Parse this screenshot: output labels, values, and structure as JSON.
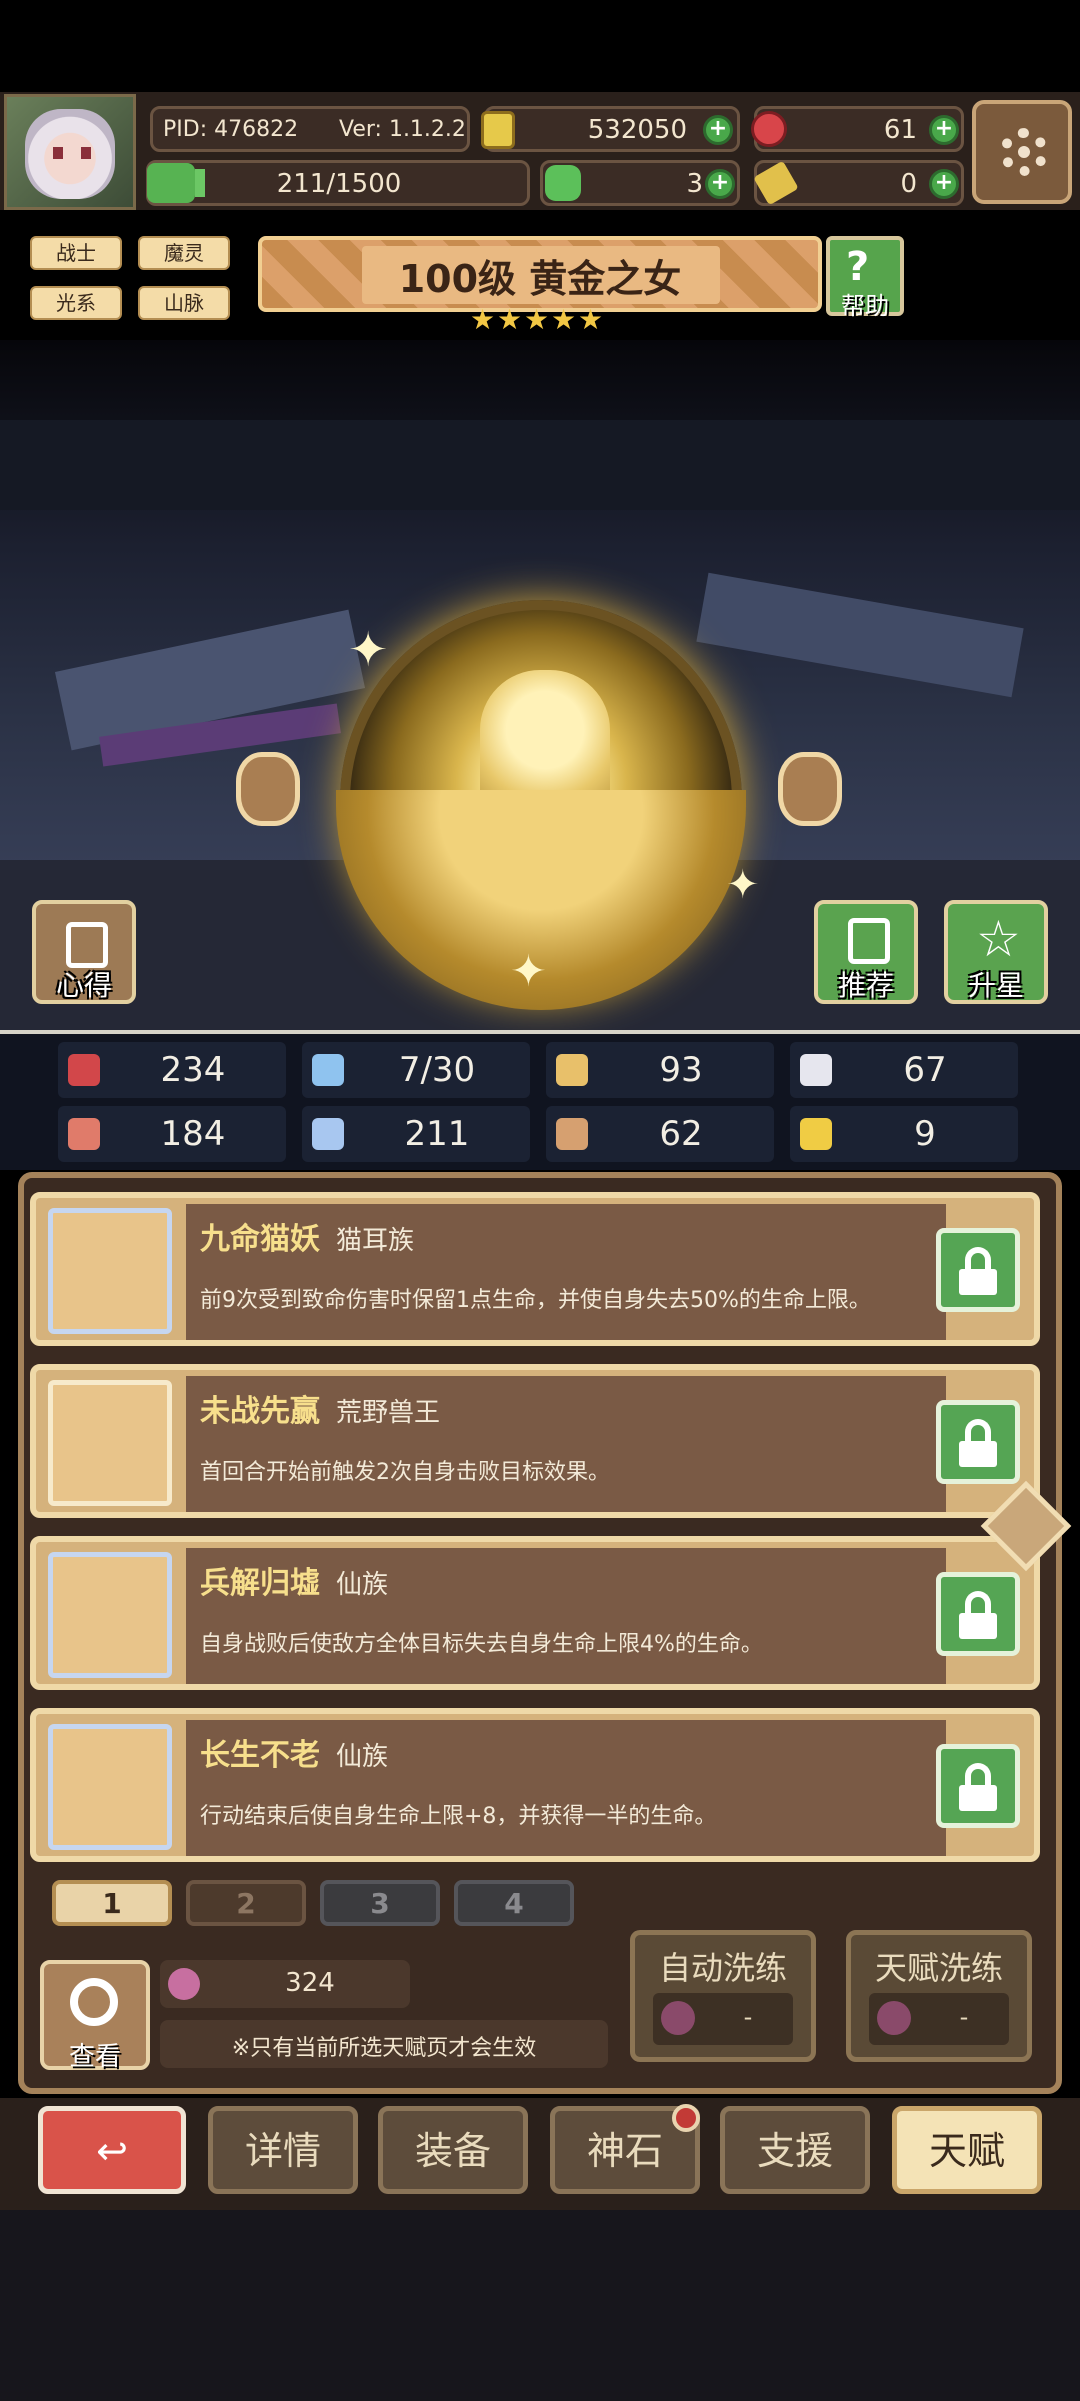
{
  "header": {
    "pid": "PID: 476822",
    "version": "Ver: 1.1.2.2",
    "gold": "532050",
    "gems": "61",
    "energy": "211/1500",
    "clover": "3",
    "keys": "0"
  },
  "tags": [
    "战士",
    "魔灵",
    "光系",
    "山脉"
  ],
  "hero": {
    "title": "100级 黄金之女",
    "stars": 5,
    "help_label": "帮助"
  },
  "scene_buttons": {
    "notes": "心得",
    "recommend": "推荐",
    "star_up": "升星"
  },
  "stats": [
    {
      "icon": "heart-icon",
      "value": "234"
    },
    {
      "icon": "water-drop-icon",
      "value": "7/30"
    },
    {
      "icon": "shield-icon",
      "value": "93"
    },
    {
      "icon": "boot-icon",
      "value": "67"
    },
    {
      "icon": "fist-icon",
      "value": "184"
    },
    {
      "icon": "book-icon",
      "value": "211"
    },
    {
      "icon": "armor-icon",
      "value": "62"
    },
    {
      "icon": "horseshoe-icon",
      "value": "9"
    }
  ],
  "talents": [
    {
      "name": "九命猫妖",
      "tribe": "猫耳族",
      "desc": "前9次受到致命伤害时保留1点生命，并使自身失去50%的生命上限。"
    },
    {
      "name": "未战先赢",
      "tribe": "荒野兽王",
      "desc": "首回合开始前触发2次自身击败目标效果。"
    },
    {
      "name": "兵解归墟",
      "tribe": "仙族",
      "desc": "自身战败后使敌方全体目标失去自身生命上限4%的生命。"
    },
    {
      "name": "长生不老",
      "tribe": "仙族",
      "desc": "行动结束后使自身生命上限+8，并获得一半的生命。"
    }
  ],
  "pages": [
    "1",
    "2",
    "3",
    "4"
  ],
  "panel": {
    "view_label": "查看",
    "berry_count": "324",
    "note": "※只有当前所选天赋页才会生效",
    "auto_refine": "自动洗练",
    "auto_refine_cost": "-",
    "talent_refine": "天赋洗练",
    "talent_refine_cost": "-"
  },
  "nav": {
    "details": "详情",
    "equip": "装备",
    "godstone": "神石",
    "support": "支援",
    "talent": "天赋"
  }
}
